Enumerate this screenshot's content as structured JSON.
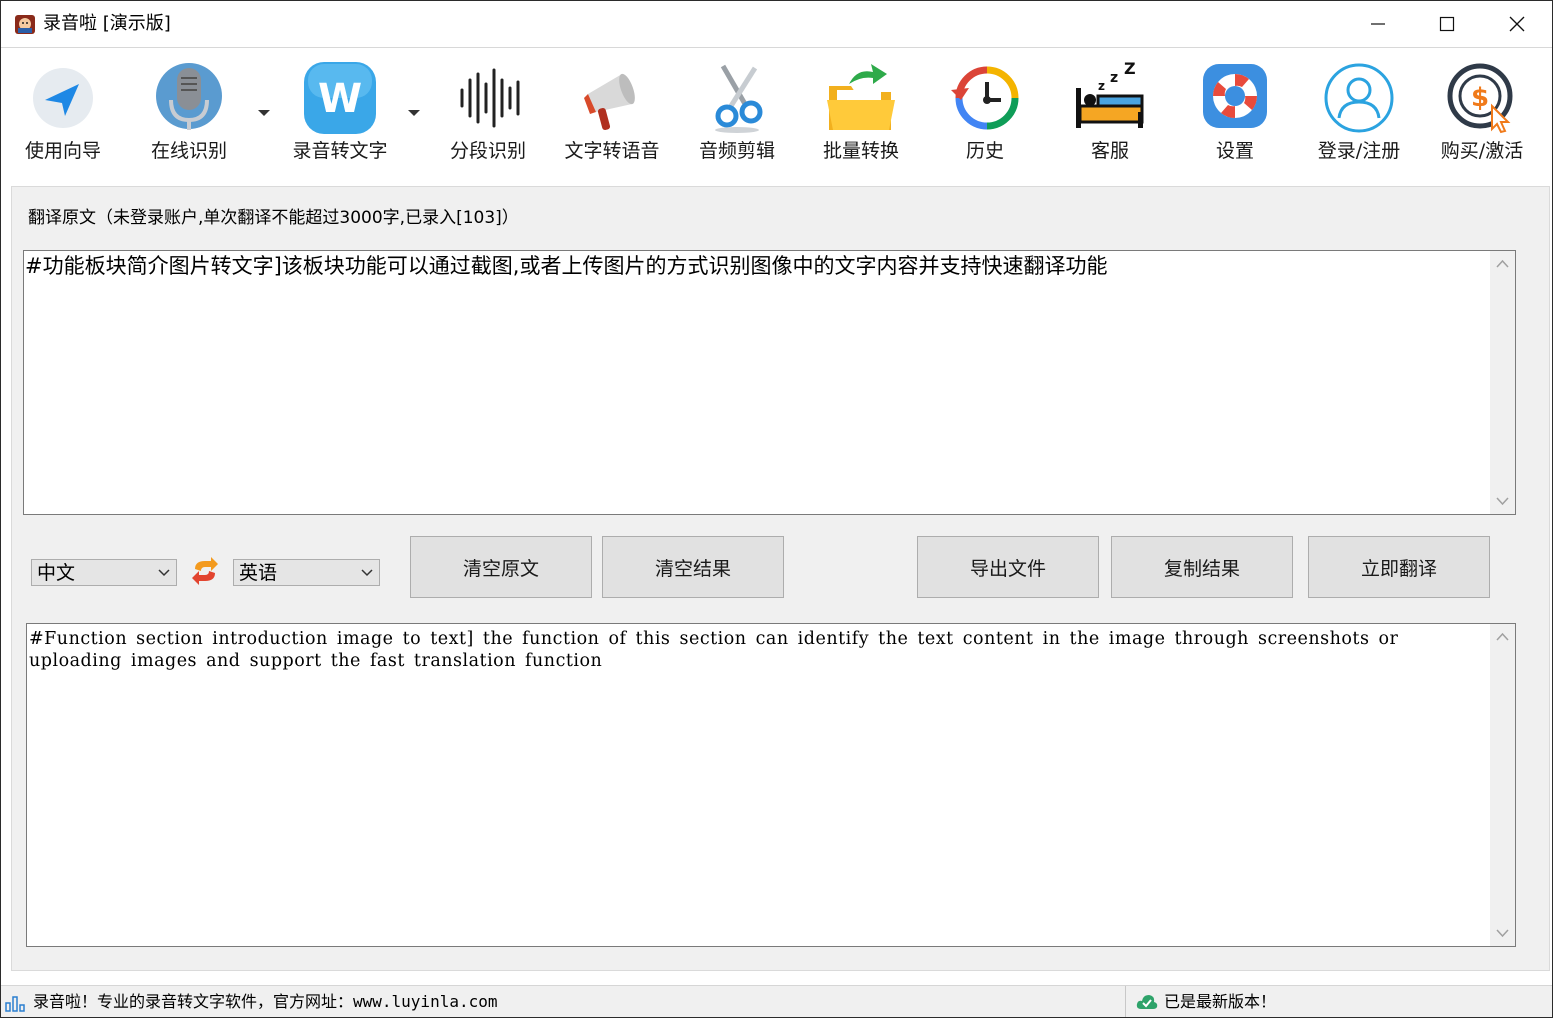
{
  "window": {
    "title": "录音啦 [演示版]"
  },
  "toolbar": {
    "items": [
      {
        "label": "使用向导",
        "icon": "navigation-arrow-icon"
      },
      {
        "label": "在线识别",
        "icon": "microphone-icon"
      },
      {
        "label": "录音转文字",
        "icon": "w-app-icon"
      },
      {
        "label": "分段识别",
        "icon": "sound-wave-icon"
      },
      {
        "label": "文字转语音",
        "icon": "megaphone-icon"
      },
      {
        "label": "音频剪辑",
        "icon": "scissors-icon"
      },
      {
        "label": "批量转换",
        "icon": "folder-arrow-icon"
      },
      {
        "label": "历史",
        "icon": "history-clock-icon"
      },
      {
        "label": "客服",
        "icon": "sleeping-bed-icon"
      },
      {
        "label": "设置",
        "icon": "lifebuoy-icon"
      },
      {
        "label": "登录/注册",
        "icon": "user-icon"
      },
      {
        "label": "购买/激活",
        "icon": "dollar-cursor-icon"
      }
    ]
  },
  "source": {
    "label": "翻译原文（未登录账户,单次翻译不能超过3000字,已录入[103]）",
    "text": "#功能板块简介图片转文字]该板块功能可以通过截图,或者上传图片的方式识别图像中的文字内容并支持快速翻译功能"
  },
  "controls": {
    "source_lang": "中文",
    "target_lang": "英语",
    "clear_source": "清空原文",
    "clear_result": "清空结果",
    "export_file": "导出文件",
    "copy_result": "复制结果",
    "translate_now": "立即翻译"
  },
  "result": {
    "text": "#Function section introduction image to text] the function of this section can identify the text content in the image through screenshots or uploading images and support the fast translation function"
  },
  "status": {
    "left": "录音啦！专业的录音转文字软件，官方网址：www.luyinla.com",
    "right": "已是最新版本！"
  },
  "colors": {
    "panel_bg": "#f0f0f0",
    "button_bg": "#e1e1e1",
    "accent_blue": "#2f8fd8",
    "accent_orange": "#f0a020"
  }
}
